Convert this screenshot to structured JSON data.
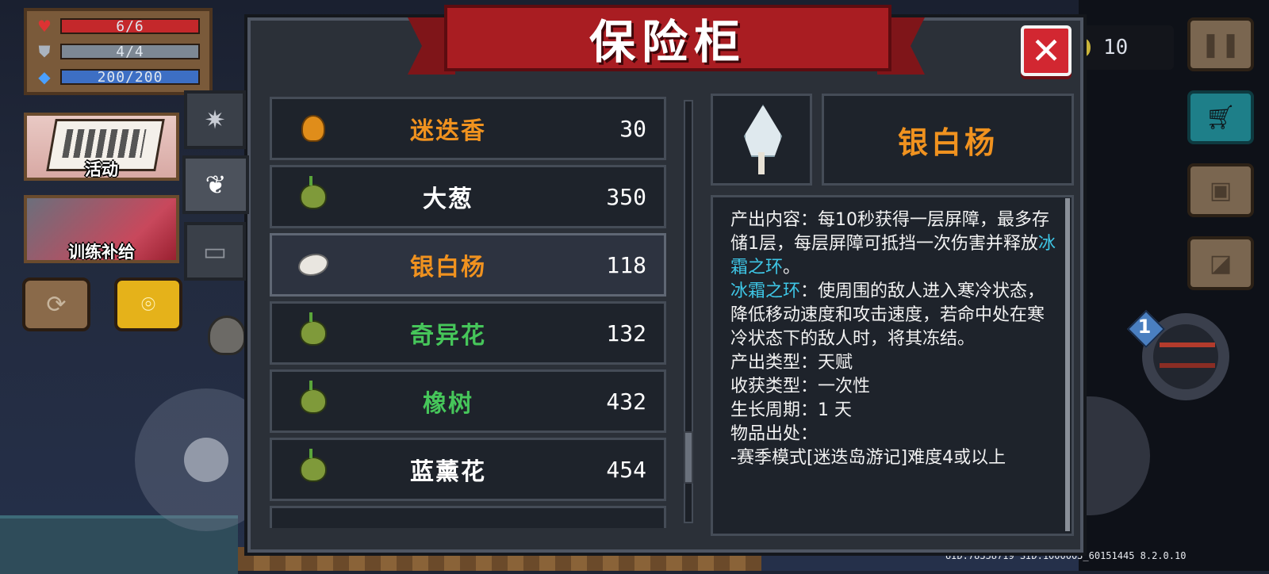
{
  "hud": {
    "hp": "6/6",
    "armor": "4/4",
    "energy": "200/200",
    "coins": "10",
    "activity_label": "活动",
    "training_label": "训练补给",
    "weapon_slot": "1",
    "version_info": "UID:78358719 SID:1000003_60151445 8.2.0.10"
  },
  "panel": {
    "title": "保险柜",
    "close_symbol": "✕",
    "tabs": [
      {
        "name": "weapons",
        "icon": "star-icon",
        "glyph": "✷"
      },
      {
        "name": "plants",
        "icon": "seedling-icon",
        "glyph": "❦"
      },
      {
        "name": "tickets",
        "icon": "ticket-icon",
        "glyph": "▭"
      }
    ]
  },
  "items": [
    {
      "name": "迷迭香",
      "qty": "30",
      "color": "#f0921f",
      "icon": "bulb-icon"
    },
    {
      "name": "大葱",
      "qty": "350",
      "color": "#ffffff",
      "icon": "seed-icon"
    },
    {
      "name": "银白杨",
      "qty": "118",
      "color": "#f0921f",
      "icon": "petal-seed-icon"
    },
    {
      "name": "奇异花",
      "qty": "132",
      "color": "#46c65a",
      "icon": "seed-icon"
    },
    {
      "name": "橡树",
      "qty": "432",
      "color": "#46c65a",
      "icon": "seed-icon"
    },
    {
      "name": "蓝薰花",
      "qty": "454",
      "color": "#ffffff",
      "icon": "seed-icon"
    }
  ],
  "detail": {
    "name": "银白杨",
    "icon": "silver-poplar-tree-icon",
    "line1_prefix": "产出内容：每10秒获得一层屏障，最多存储1层，每层屏障可抵挡一次伤害并释放",
    "line1_highlight": "冰霜之环",
    "line1_suffix": "。",
    "frost_title": "冰霜之环",
    "frost_desc": "：使周围的敌人进入寒冷状态，降低移动速度和攻击速度，若命中处在寒冷状态下的敌人时，将其冻结。",
    "output_type": "产出类型：天赋",
    "harvest_type": "收获类型：一次性",
    "growth_cycle": "生长周期：1 天",
    "source_label": "物品出处：",
    "source_value": "-赛季模式[迷迭岛游记]难度4或以上"
  }
}
